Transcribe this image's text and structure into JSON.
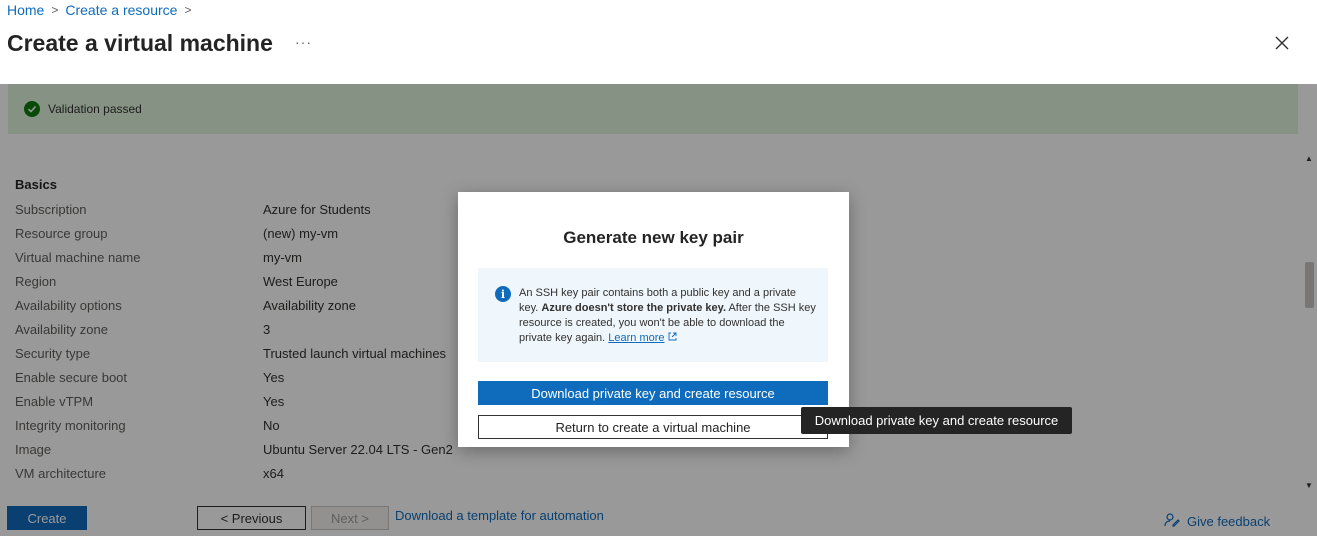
{
  "breadcrumb": {
    "home": "Home",
    "create_resource": "Create a resource",
    "sep": ">"
  },
  "header": {
    "title": "Create a virtual machine",
    "more": "···"
  },
  "validation": {
    "text": "Validation passed"
  },
  "basics": {
    "title": "Basics",
    "rows": [
      {
        "label": "Subscription",
        "value": "Azure for Students"
      },
      {
        "label": "Resource group",
        "value": "(new) my-vm"
      },
      {
        "label": "Virtual machine name",
        "value": "my-vm"
      },
      {
        "label": "Region",
        "value": "West Europe"
      },
      {
        "label": "Availability options",
        "value": "Availability zone"
      },
      {
        "label": "Availability zone",
        "value": "3"
      },
      {
        "label": "Security type",
        "value": "Trusted launch virtual machines"
      },
      {
        "label": "Enable secure boot",
        "value": "Yes"
      },
      {
        "label": "Enable vTPM",
        "value": "Yes"
      },
      {
        "label": "Integrity monitoring",
        "value": "No"
      },
      {
        "label": "Image",
        "value": "Ubuntu Server 22.04 LTS - Gen2"
      },
      {
        "label": "VM architecture",
        "value": "x64"
      }
    ]
  },
  "footer": {
    "create": "Create",
    "previous": "< Previous",
    "next": "Next >",
    "template_link": "Download a template for automation",
    "feedback": "Give feedback"
  },
  "modal": {
    "title": "Generate new key pair",
    "info_text_1": "An SSH key pair contains both a public key and a private key.",
    "info_text_bold": "Azure doesn't store the private key.",
    "info_text_2": "After the SSH key resource is created, you won't be able to download the private key again.",
    "learn_more": "Learn more",
    "primary_button": "Download private key and create resource",
    "secondary_button": "Return to create a virtual machine"
  },
  "tooltip": {
    "text": "Download private key and create resource"
  },
  "colors": {
    "accent": "#0f6cbd",
    "success": "#107c10",
    "validation_bg": "#dff6dd",
    "info_bg": "#eff6fc"
  }
}
